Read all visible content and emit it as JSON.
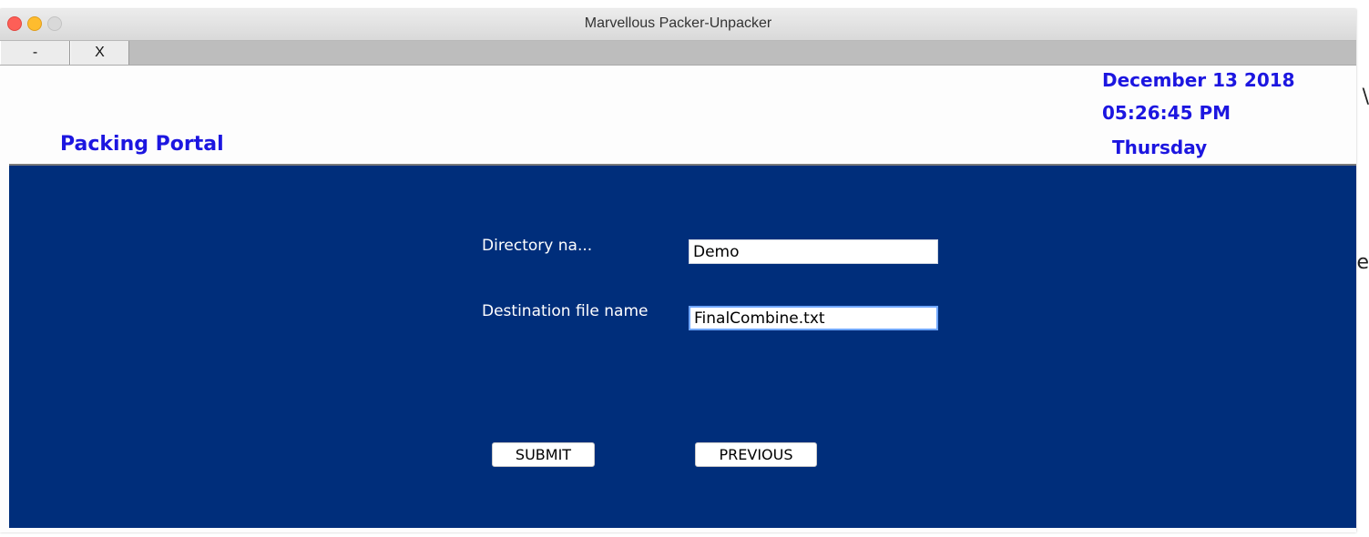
{
  "window": {
    "title": "Marvellous Packer-Unpacker"
  },
  "tabs": [
    {
      "label": "-"
    },
    {
      "label": "X"
    }
  ],
  "header": {
    "portal_title": "Packing Portal",
    "date": "December 13 2018",
    "time": "05:26:45 PM",
    "day": "Thursday"
  },
  "form": {
    "directory_label": "Directory na...",
    "directory_value": "Demo",
    "destination_label": "Destination file name",
    "destination_value": "FinalCombine.txt"
  },
  "buttons": {
    "submit": "SUBMIT",
    "previous": "PREVIOUS"
  },
  "background_fragments": {
    "right_edge_top": "\\",
    "right_edge_mid": "e"
  },
  "colors": {
    "panel": "#002e7b",
    "accent_text": "#1c16e0"
  }
}
